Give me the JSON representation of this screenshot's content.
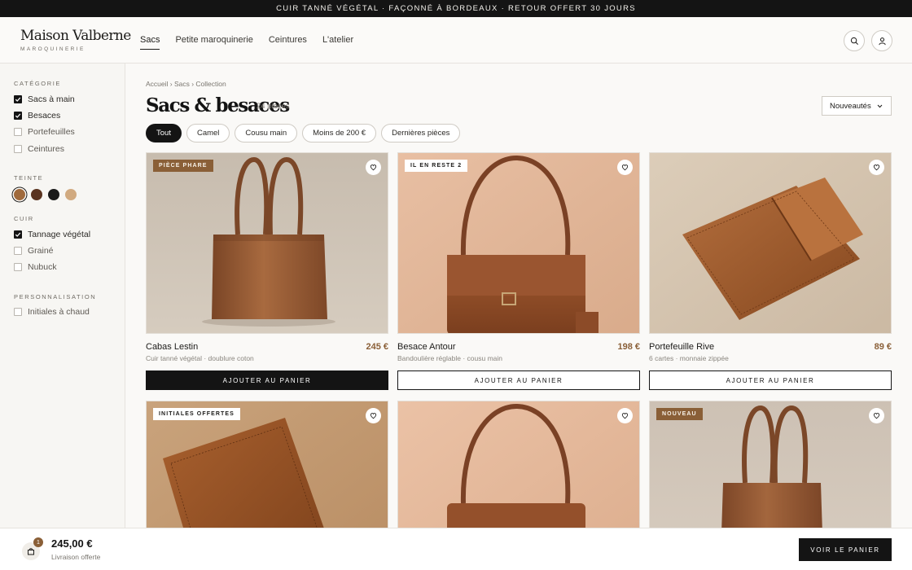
{
  "announcement": "CUIR TANNÉ VÉGÉTAL · FAÇONNÉ À BORDEAUX · RETOUR OFFERT 30 JOURS",
  "brand": {
    "name": "Maison Valberne",
    "tagline": "MAROQUINERIE"
  },
  "nav": [
    "Sacs",
    "Petite maroquinerie",
    "Ceintures",
    "L'atelier"
  ],
  "nav_active": "Sacs",
  "header_icons": [
    "search-icon",
    "user-icon"
  ],
  "filters": {
    "category": {
      "title": "CATÉGORIE",
      "items": [
        {
          "label": "Sacs à main",
          "checked": true
        },
        {
          "label": "Besaces",
          "checked": true
        },
        {
          "label": "Portefeuilles",
          "checked": false
        },
        {
          "label": "Ceintures",
          "checked": false
        }
      ]
    },
    "tint": {
      "title": "TEINTE",
      "swatches": [
        "#a06a3c",
        "#5a3420",
        "#1a1a1a",
        "#d1aa80"
      ],
      "selected": 0
    },
    "leather": {
      "title": "CUIR",
      "items": [
        {
          "label": "Tannage végétal",
          "checked": true
        },
        {
          "label": "Grainé",
          "checked": false
        },
        {
          "label": "Nubuck",
          "checked": false
        }
      ]
    },
    "personalisation": {
      "title": "PERSONNALISATION",
      "items": [
        {
          "label": "Initiales à chaud",
          "checked": false
        }
      ]
    }
  },
  "breadcrumb": "Accueil › Sacs › Collection",
  "page_title": "Sacs & besaces",
  "count": "24 pièces",
  "sort_label": "Nouveautés",
  "chips": [
    "Tout",
    "Camel",
    "Cousu main",
    "Moins de 200 €",
    "Dernières pièces"
  ],
  "chip_active": "Tout",
  "products": [
    {
      "badge": "PIÈCE PHARE",
      "badge_style": "dark",
      "name": "Cabas Lestin",
      "price": "245 €",
      "desc": "Cuir tanné végétal · doublure coton",
      "cta": "AJOUTER AU PANIER",
      "cta_style": "dark",
      "image": "tote",
      "bg": "#c9beb1"
    },
    {
      "badge": "IL EN RESTE 2",
      "badge_style": "light",
      "name": "Besace Antour",
      "price": "198 €",
      "desc": "Bandoulière réglable · cousu main",
      "cta": "AJOUTER AU PANIER",
      "cta_style": "light",
      "image": "shoulder",
      "bg": "#e0b699"
    },
    {
      "badge": "",
      "badge_style": "",
      "name": "Portefeuille Rive",
      "price": "89 €",
      "desc": "6 cartes · monnaie zippée",
      "cta": "AJOUTER AU PANIER",
      "cta_style": "light",
      "image": "wallet",
      "bg": "#d6c7b4"
    },
    {
      "badge": "INITIALES OFFERTES",
      "badge_style": "light",
      "image": "wallet2",
      "bg": "#c9a37c"
    },
    {
      "badge": "",
      "badge_style": "",
      "image": "shoulder",
      "bg": "#e4b89a"
    },
    {
      "badge": "NOUVEAU",
      "badge_style": "dark",
      "image": "tote",
      "bg": "#cfc3b6"
    }
  ],
  "cart": {
    "count": "1",
    "total": "245,00 €",
    "shipping": "Livraison offerte",
    "cta": "VOIR LE PANIER"
  }
}
